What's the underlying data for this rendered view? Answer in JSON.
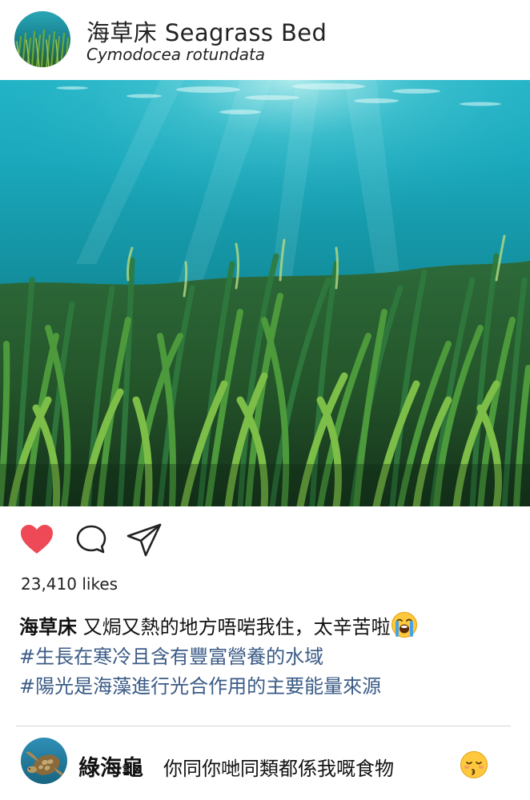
{
  "post": {
    "username": "海草床 Seagrass Bed",
    "subtitle": "Cymodocea rotundata",
    "likes": "23,410 likes"
  },
  "caption": {
    "user": "海草床",
    "text": " 又焗又熱的地方唔啱我住，太辛苦啦",
    "emoji": "loudly-crying-face",
    "hashtag1": "#生長在寒冷且含有豐富營養的水域",
    "hashtag2": "#陽光是海藻進行光合作用的主要能量來源"
  },
  "comment": {
    "user": "綠海龜",
    "text": "你同你哋同類都係我嘅食物",
    "emoji": "kissing-face-with-closed-eyes"
  },
  "colors": {
    "like_heart": "#ed4956",
    "hashtag": "#3b5b86",
    "divider": "#d5d5d5"
  },
  "icons": [
    "heart-icon",
    "comment-icon",
    "share-icon"
  ]
}
